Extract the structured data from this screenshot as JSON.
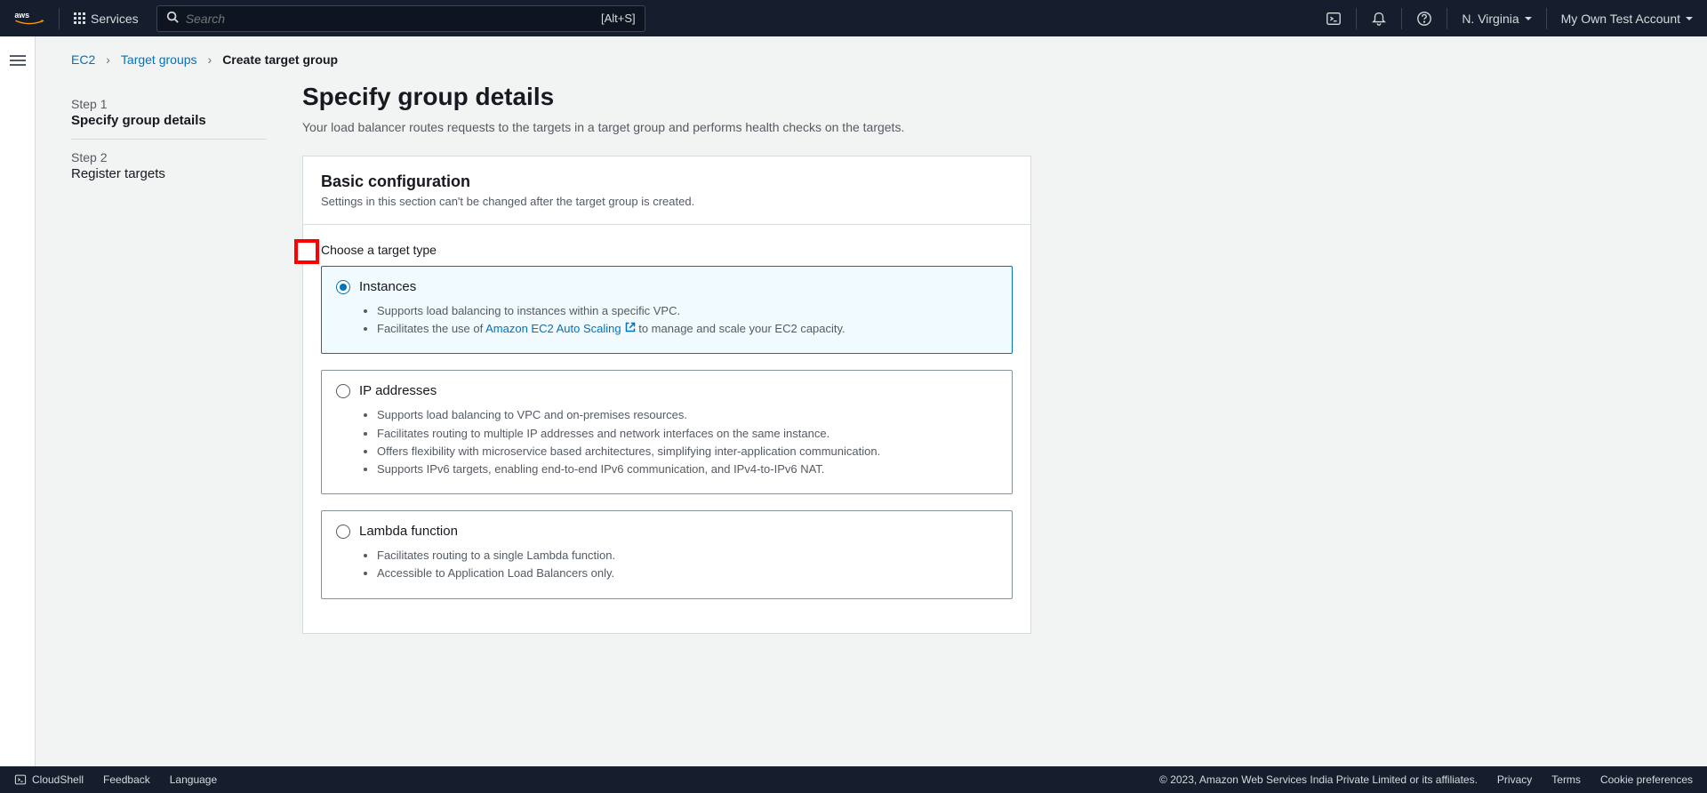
{
  "header": {
    "services_label": "Services",
    "search_placeholder": "Search",
    "search_hint": "[Alt+S]",
    "region": "N. Virginia",
    "account": "My Own Test Account"
  },
  "breadcrumbs": {
    "l1": "EC2",
    "l2": "Target groups",
    "l3": "Create target group"
  },
  "steps": [
    {
      "num": "Step 1",
      "title": "Specify group details"
    },
    {
      "num": "Step 2",
      "title": "Register targets"
    }
  ],
  "page": {
    "title": "Specify group details",
    "subtitle": "Your load balancer routes requests to the targets in a target group and performs health checks on the targets."
  },
  "panel": {
    "title": "Basic configuration",
    "help": "Settings in this section can't be changed after the target group is created.",
    "section_label": "Choose a target type"
  },
  "target_types": {
    "instances": {
      "title": "Instances",
      "b1": "Supports load balancing to instances within a specific VPC.",
      "b2_pre": "Facilitates the use of ",
      "b2_link": "Amazon EC2 Auto Scaling",
      "b2_post": " to manage and scale your EC2 capacity."
    },
    "ip": {
      "title": "IP addresses",
      "b1": "Supports load balancing to VPC and on-premises resources.",
      "b2": "Facilitates routing to multiple IP addresses and network interfaces on the same instance.",
      "b3": "Offers flexibility with microservice based architectures, simplifying inter-application communication.",
      "b4": "Supports IPv6 targets, enabling end-to-end IPv6 communication, and IPv4-to-IPv6 NAT."
    },
    "lambda": {
      "title": "Lambda function",
      "b1": "Facilitates routing to a single Lambda function.",
      "b2": "Accessible to Application Load Balancers only."
    }
  },
  "footer": {
    "cloudshell": "CloudShell",
    "feedback": "Feedback",
    "language": "Language",
    "copyright": "© 2023, Amazon Web Services India Private Limited or its affiliates.",
    "privacy": "Privacy",
    "terms": "Terms",
    "cookies": "Cookie preferences"
  }
}
